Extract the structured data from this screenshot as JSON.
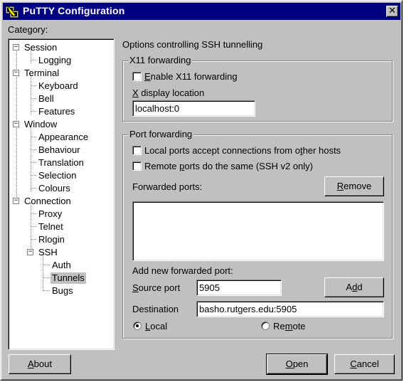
{
  "window": {
    "title": "PuTTY Configuration",
    "close_glyph": "✕"
  },
  "category": {
    "label": "Category:",
    "tree": [
      {
        "label": "Session",
        "expander": "−"
      },
      {
        "label": "Logging"
      },
      {
        "label": "Terminal",
        "expander": "−"
      },
      {
        "label": "Keyboard"
      },
      {
        "label": "Bell"
      },
      {
        "label": "Features"
      },
      {
        "label": "Window",
        "expander": "−"
      },
      {
        "label": "Appearance"
      },
      {
        "label": "Behaviour"
      },
      {
        "label": "Translation"
      },
      {
        "label": "Selection"
      },
      {
        "label": "Colours"
      },
      {
        "label": "Connection",
        "expander": "−"
      },
      {
        "label": "Proxy"
      },
      {
        "label": "Telnet"
      },
      {
        "label": "Rlogin"
      },
      {
        "label": "SSH",
        "expander": "−"
      },
      {
        "label": "Auth"
      },
      {
        "label": "Tunnels",
        "selected": true
      },
      {
        "label": "Bugs"
      }
    ]
  },
  "panel": {
    "heading": "Options controlling SSH tunnelling",
    "x11": {
      "group_title": "X11 forwarding",
      "enable_label_pre": "",
      "enable_label_accel": "E",
      "enable_label_post": "nable X11 forwarding",
      "enable_checked": false,
      "display_label_accel": "X",
      "display_label_post": " display location",
      "display_value": "localhost:0"
    },
    "port": {
      "group_title": "Port forwarding",
      "local_accept_pre": "Local ports accept connections from o",
      "local_accept_accel": "t",
      "local_accept_post": "her hosts",
      "local_accept_checked": false,
      "remote_same_pre": "Remote ",
      "remote_same_accel": "p",
      "remote_same_post": "orts do the same (SSH v2 only)",
      "remote_same_checked": false,
      "forwarded_label": "Forwarded ports:",
      "remove_accel": "R",
      "remove_post": "emove",
      "forwarded_list": [],
      "add_new_label": "Add new forwarded port:",
      "source_accel": "S",
      "source_post": "ource port",
      "source_value": "5905",
      "add_pre": "A",
      "add_accel": "d",
      "add_post": "d",
      "destination_label": "Destination",
      "destination_value": "basho.rutgers.edu:5905",
      "local_radio_accel": "L",
      "local_radio_post": "ocal",
      "local_selected": true,
      "remote_radio_pre": "Re",
      "remote_radio_accel": "m",
      "remote_radio_post": "ote",
      "remote_selected": false
    }
  },
  "buttons": {
    "about_accel": "A",
    "about_post": "bout",
    "open_accel": "O",
    "open_post": "pen",
    "cancel_accel": "C",
    "cancel_post": "ancel"
  }
}
